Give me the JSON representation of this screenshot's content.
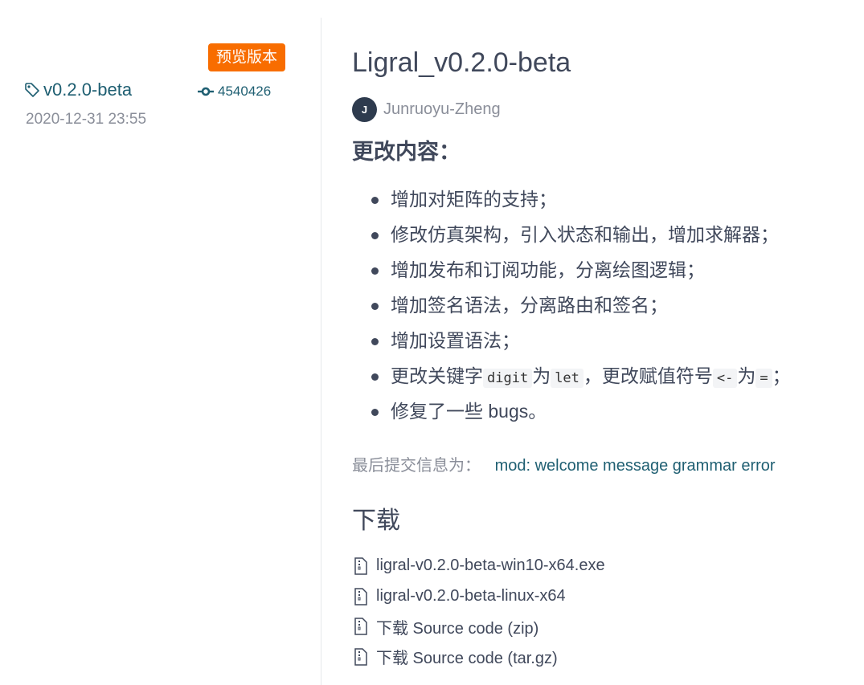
{
  "release": {
    "badge": "预览版本",
    "tag": "v0.2.0-beta",
    "commit": "4540426",
    "date": "2020-12-31 23:55"
  },
  "main": {
    "title": "Ligral_v0.2.0-beta",
    "author": {
      "initial": "J",
      "name": "Junruoyu-Zheng"
    },
    "changes_heading": "更改内容：",
    "changes": [
      "增加对矩阵的支持；",
      "修改仿真架构，引入状态和输出，增加求解器；",
      "增加发布和订阅功能，分离绘图逻辑；",
      "增加签名语法，分离路由和签名；",
      "增加设置语法；",
      {
        "t1": "更改关键字",
        "c1": "digit",
        "t2": "为",
        "c2": "let",
        "t3": "，更改赋值符号",
        "c3": "<-",
        "t4": "为",
        "c4": "=",
        "t5": "；"
      },
      "修复了一些 bugs。"
    ],
    "last_commit_label": "最后提交信息为：",
    "last_commit_message": "mod: welcome message grammar error",
    "downloads_heading": "下载",
    "downloads": [
      "ligral-v0.2.0-beta-win10-x64.exe",
      "ligral-v0.2.0-beta-linux-x64",
      "下载 Source code (zip)",
      "下载 Source code (tar.gz)"
    ]
  },
  "colors": {
    "badge": "#f86d00",
    "link": "#1f5f72",
    "text": "#40485b",
    "muted": "#8a8e99"
  },
  "icons": {
    "tag": "tag-icon",
    "commit": "commit-icon",
    "file": "file-zip-icon"
  }
}
